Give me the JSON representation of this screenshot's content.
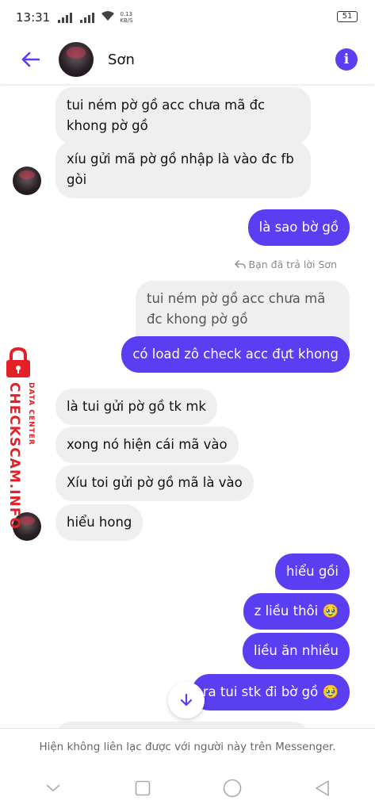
{
  "status_bar": {
    "time": "13:31",
    "net_speed_value": "0.13",
    "net_speed_unit": "KB/S",
    "battery": "51"
  },
  "header": {
    "contact_name": "Sơn"
  },
  "messages": [
    {
      "side": "in",
      "text": "tui ném pờ gồ acc chưa mã đc khong pờ gồ"
    },
    {
      "side": "in",
      "text": "xíu gửi mã pờ gồ nhập là vào đc fb gòi"
    },
    {
      "side": "out",
      "text": "là sao bờ gồ"
    },
    {
      "side": "quoted",
      "text": "tui ném pờ gồ acc chưa mã đc khong pờ gồ"
    },
    {
      "side": "out",
      "text": "có load zô check acc đựt khong"
    },
    {
      "side": "in",
      "text": "là tui gửi pờ gồ tk mk"
    },
    {
      "side": "in",
      "text": "xong nó hiện cái mã vào"
    },
    {
      "side": "in",
      "text": "Xíu toi gửi pờ gồ mã là vào"
    },
    {
      "side": "in",
      "text": "hiểu hong"
    },
    {
      "side": "out",
      "text": "hiểu gồi"
    },
    {
      "side": "out",
      "text": "z liều thôi 🥹"
    },
    {
      "side": "out",
      "text": "liều ăn nhiều"
    },
    {
      "side": "out",
      "text": "ra tui stk đi bờ gồ 🥹"
    }
  ],
  "reply_note": "Bạn đã trả lời Sơn",
  "watermark": {
    "main": "CHECKSCAM.INFO",
    "sub": "DATA CENTER"
  },
  "footer_notice": "Hiện không liên lạc được với người này trên Messenger.",
  "colors": {
    "accent": "#5a3ef1",
    "incoming_bubble": "#efeff0",
    "watermark": "#e32027"
  }
}
